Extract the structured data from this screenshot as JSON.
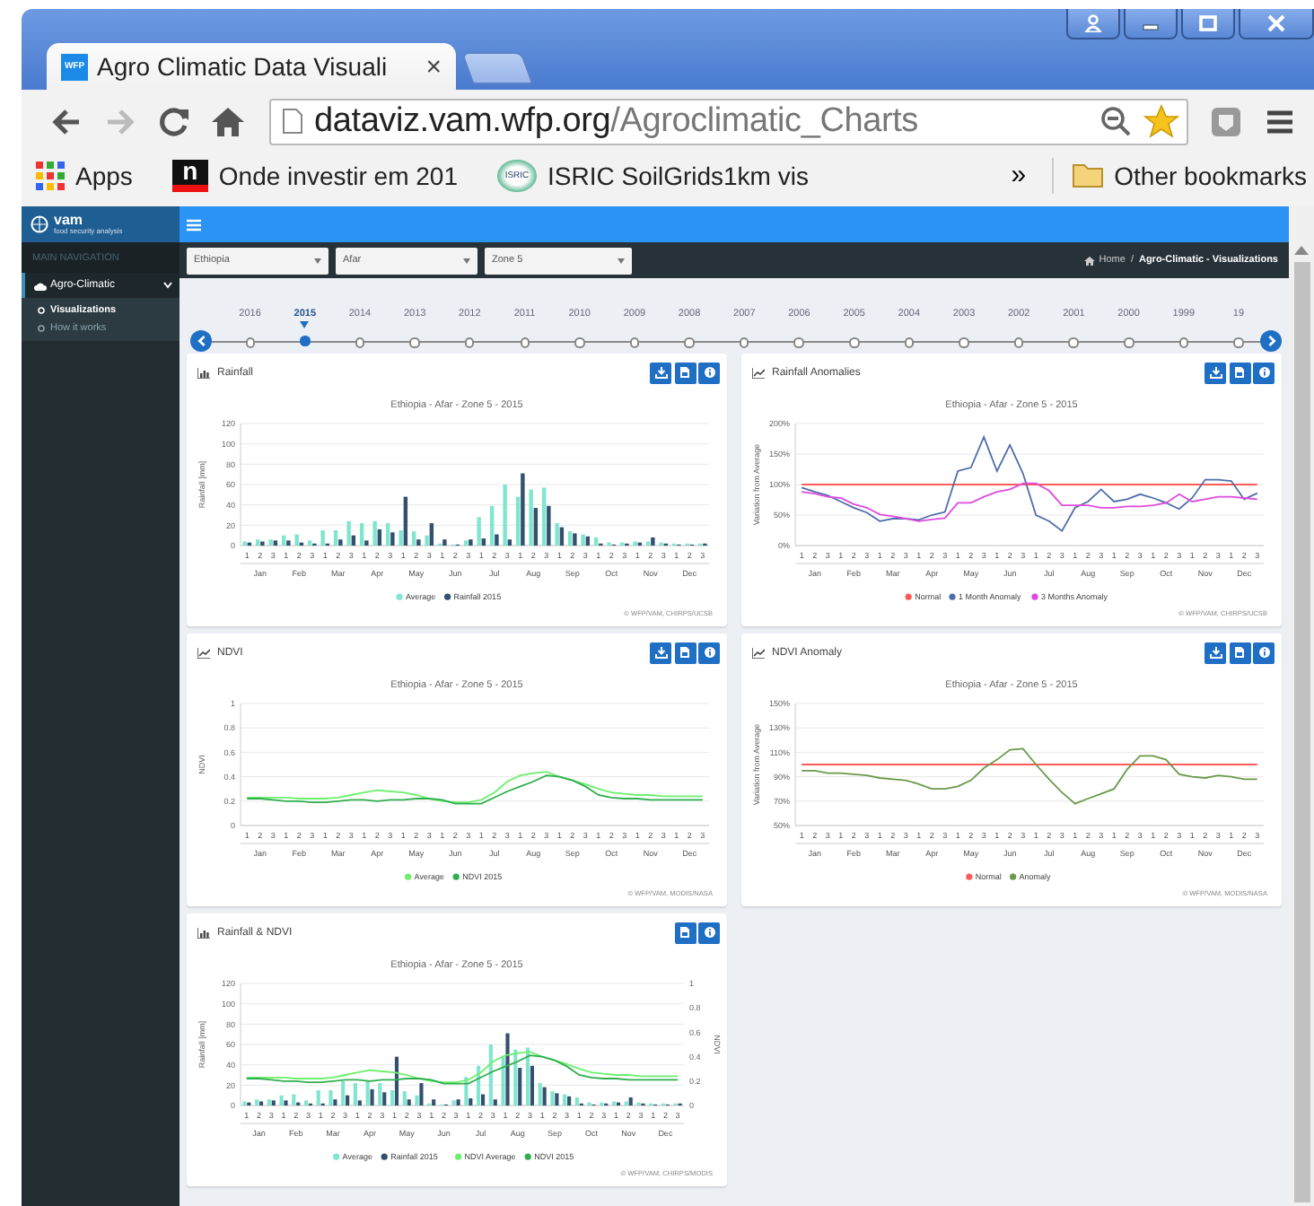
{
  "browser": {
    "tab": {
      "favicon": "WFP",
      "title": "Agro Climatic Data Visuali",
      "close": "×"
    },
    "url": {
      "host": "dataviz.vam.wfp.org",
      "path": "/Agroclimatic_Charts"
    },
    "bookmarks": [
      {
        "kind": "apps",
        "label": "Apps"
      },
      {
        "kind": "letter",
        "icon_text": "n",
        "label": "Onde investir em 201"
      },
      {
        "kind": "badge",
        "icon_text": "ISRIC",
        "label": "ISRIC SoilGrids1km vis"
      }
    ],
    "overflow": "»",
    "other_bookmarks": "Other bookmarks"
  },
  "sidebar": {
    "logo": {
      "name": "vam",
      "tagline": "food security analysis"
    },
    "header": "MAIN NAVIGATION",
    "menu": [
      {
        "label": "Agro-Climatic",
        "expanded": true,
        "children": [
          {
            "label": "Visualizations",
            "selected": true
          },
          {
            "label": "How it works",
            "selected": false
          }
        ]
      }
    ]
  },
  "filters": [
    {
      "value": "Ethiopia"
    },
    {
      "value": "Afar"
    },
    {
      "value": "Zone 5"
    }
  ],
  "breadcrumb": {
    "items": [
      {
        "label": "Home",
        "kind": "home"
      },
      {
        "label": "Agro-Climatic - Visualizations",
        "kind": "current"
      }
    ],
    "separator": "/"
  },
  "timeline": {
    "years": [
      {
        "label": "2016",
        "selected": false
      },
      {
        "label": "2015",
        "selected": true
      },
      {
        "label": "2014",
        "selected": false
      },
      {
        "label": "2013",
        "selected": false
      },
      {
        "label": "2012",
        "selected": false
      },
      {
        "label": "2011",
        "selected": false
      },
      {
        "label": "2010",
        "selected": false
      },
      {
        "label": "2009",
        "selected": false
      },
      {
        "label": "2008",
        "selected": false
      },
      {
        "label": "2007",
        "selected": false
      },
      {
        "label": "2006",
        "selected": false
      },
      {
        "label": "2005",
        "selected": false
      },
      {
        "label": "2004",
        "selected": false
      },
      {
        "label": "2003",
        "selected": false
      },
      {
        "label": "2002",
        "selected": false
      },
      {
        "label": "2001",
        "selected": false
      },
      {
        "label": "2000",
        "selected": false
      },
      {
        "label": "1999",
        "selected": false
      },
      {
        "label": "19",
        "selected": false
      }
    ]
  },
  "cards": [
    {
      "title": "Rainfall",
      "buttons": [
        {
          "kind": "download"
        },
        {
          "kind": "image"
        },
        {
          "kind": "info"
        }
      ],
      "credit": "© WFP/VAM, CHIRPS/UCSB",
      "months": [
        "Jan",
        "Feb",
        "Mar",
        "Apr",
        "May",
        "Jun",
        "Jul",
        "Aug",
        "Sep",
        "Oct",
        "Nov",
        "Dec"
      ],
      "chart_data": {
        "type": "bar",
        "title": "Ethiopia - Afar - Zone 5 - 2015",
        "ylabel": "Rainfall [mm]",
        "categories": [
          "1",
          "2",
          "3",
          "1",
          "2",
          "3",
          "1",
          "2",
          "3",
          "1",
          "2",
          "3",
          "1",
          "2",
          "3",
          "1",
          "2",
          "3",
          "1",
          "2",
          "3",
          "1",
          "2",
          "3",
          "1",
          "2",
          "3",
          "1",
          "2",
          "3",
          "1",
          "2",
          "3",
          "1",
          "2",
          "3"
        ],
        "ylim": [
          0,
          120
        ],
        "yticks": [
          0,
          20,
          40,
          60,
          80,
          100,
          120
        ],
        "grid": true,
        "legend": "bottom",
        "series": [
          {
            "name": "Average",
            "color": "#80e6cf",
            "values": [
              4,
              6,
              6,
              10,
              11,
              5,
              15,
              15,
              24,
              22,
              24,
              22,
              15,
              14,
              10,
              2,
              1,
              5,
              28,
              39,
              60,
              48,
              55,
              57,
              22,
              14,
              11,
              8,
              3,
              3,
              4,
              4,
              3,
              2,
              2,
              2
            ]
          },
          {
            "name": "Rainfall 2015",
            "color": "#34506f",
            "values": [
              3,
              4,
              5,
              5,
              3,
              2,
              2,
              6,
              10,
              5,
              16,
              13,
              48,
              6,
              22,
              6,
              1,
              6,
              7,
              11,
              6,
              71,
              37,
              39,
              18,
              12,
              9,
              2,
              1,
              2,
              3,
              8,
              2,
              1,
              1,
              2
            ]
          }
        ]
      }
    },
    {
      "title": "Rainfall Anomalies",
      "buttons": [
        {
          "kind": "download"
        },
        {
          "kind": "image"
        },
        {
          "kind": "info"
        }
      ],
      "credit": "© WFP/VAM, CHIRPS/UCSB",
      "months": [
        "Jan",
        "Feb",
        "Mar",
        "Apr",
        "May",
        "Jun",
        "Jul",
        "Aug",
        "Sep",
        "Oct",
        "Nov",
        "Dec"
      ],
      "chart_data": {
        "type": "line",
        "title": "Ethiopia - Afar - Zone 5 - 2015",
        "ylabel": "Variation from Average",
        "categories": [
          "1",
          "2",
          "3",
          "1",
          "2",
          "3",
          "1",
          "2",
          "3",
          "1",
          "2",
          "3",
          "1",
          "2",
          "3",
          "1",
          "2",
          "3",
          "1",
          "2",
          "3",
          "1",
          "2",
          "3",
          "1",
          "2",
          "3",
          "1",
          "2",
          "3",
          "1",
          "2",
          "3",
          "1",
          "2",
          "3"
        ],
        "grid": true,
        "legend": "bottom",
        "ylim": [
          0,
          200
        ],
        "yticks": [
          {
            "value": 0,
            "label": "0%"
          },
          {
            "value": 50,
            "label": "50%"
          },
          {
            "value": 100,
            "label": "100%"
          },
          {
            "value": 150,
            "label": "150%"
          },
          {
            "value": 200,
            "label": "200%"
          }
        ],
        "series": [
          {
            "name": "Normal",
            "color": "#ff5a5a",
            "values": [
              100,
              100,
              100,
              100,
              100,
              100,
              100,
              100,
              100,
              100,
              100,
              100,
              100,
              100,
              100,
              100,
              100,
              100,
              100,
              100,
              100,
              100,
              100,
              100,
              100,
              100,
              100,
              100,
              100,
              100,
              100,
              100,
              100,
              100,
              100,
              100
            ]
          },
          {
            "name": "1 Month Anomaly",
            "color": "#4e6ea8",
            "values": [
              95,
              88,
              82,
              72,
              62,
              54,
              40,
              44,
              44,
              42,
              50,
              55,
              122,
              128,
              178,
              122,
              165,
              118,
              50,
              40,
              24,
              62,
              72,
              92,
              72,
              76,
              84,
              78,
              70,
              60,
              78,
              108,
              108,
              106,
              76,
              86
            ]
          },
          {
            "name": "3 Months Anomaly",
            "color": "#e04ae0",
            "values": [
              88,
              85,
              80,
              78,
              68,
              62,
              51,
              48,
              44,
              40,
              43,
              45,
              70,
              70,
              80,
              88,
              92,
              102,
              102,
              90,
              66,
              66,
              66,
              62,
              62,
              64,
              64,
              66,
              70,
              84,
              72,
              76,
              80,
              80,
              78,
              76
            ]
          }
        ]
      }
    },
    {
      "title": "NDVI",
      "buttons": [
        {
          "kind": "download"
        },
        {
          "kind": "image"
        },
        {
          "kind": "info"
        }
      ],
      "credit": "© WFP/VAM, MODIS/NASA",
      "months": [
        "Jan",
        "Feb",
        "Mar",
        "Apr",
        "May",
        "Jun",
        "Jul",
        "Aug",
        "Sep",
        "Oct",
        "Nov",
        "Dec"
      ],
      "chart_data": {
        "type": "line",
        "title": "Ethiopia - Afar - Zone 5 - 2015",
        "ylabel": "NDVI",
        "categories": [
          "1",
          "2",
          "3",
          "1",
          "2",
          "3",
          "1",
          "2",
          "3",
          "1",
          "2",
          "3",
          "1",
          "2",
          "3",
          "1",
          "2",
          "3",
          "1",
          "2",
          "3",
          "1",
          "2",
          "3",
          "1",
          "2",
          "3",
          "1",
          "2",
          "3",
          "1",
          "2",
          "3",
          "1",
          "2",
          "3"
        ],
        "ylim": [
          0,
          1
        ],
        "yticks": [
          0,
          0.2,
          0.4,
          0.6,
          0.8,
          1
        ],
        "grid": true,
        "legend": "bottom",
        "series": [
          {
            "name": "Average",
            "color": "#6cf06c",
            "values": [
              0.23,
              0.23,
              0.23,
              0.23,
              0.22,
              0.22,
              0.22,
              0.23,
              0.25,
              0.27,
              0.29,
              0.28,
              0.27,
              0.25,
              0.22,
              0.2,
              0.19,
              0.19,
              0.21,
              0.27,
              0.36,
              0.41,
              0.43,
              0.44,
              0.4,
              0.37,
              0.34,
              0.3,
              0.27,
              0.26,
              0.25,
              0.25,
              0.24,
              0.24,
              0.24,
              0.24
            ]
          },
          {
            "name": "NDVI 2015",
            "color": "#2fae4e",
            "values": [
              0.22,
              0.22,
              0.21,
              0.2,
              0.2,
              0.19,
              0.19,
              0.2,
              0.21,
              0.21,
              0.2,
              0.21,
              0.21,
              0.22,
              0.22,
              0.21,
              0.18,
              0.18,
              0.18,
              0.23,
              0.28,
              0.32,
              0.36,
              0.41,
              0.4,
              0.37,
              0.32,
              0.25,
              0.23,
              0.22,
              0.22,
              0.21,
              0.21,
              0.21,
              0.21,
              0.21
            ]
          }
        ]
      }
    },
    {
      "title": "NDVI Anomaly",
      "buttons": [
        {
          "kind": "download"
        },
        {
          "kind": "image"
        },
        {
          "kind": "info"
        }
      ],
      "credit": "© WFP/VAM, MODIS/NASA",
      "months": [
        "Jan",
        "Feb",
        "Mar",
        "Apr",
        "May",
        "Jun",
        "Jul",
        "Aug",
        "Sep",
        "Oct",
        "Nov",
        "Dec"
      ],
      "chart_data": {
        "type": "line",
        "title": "Ethiopia - Afar - Zone 5 - 2015",
        "ylabel": "Variation from Average",
        "categories": [
          "1",
          "2",
          "3",
          "1",
          "2",
          "3",
          "1",
          "2",
          "3",
          "1",
          "2",
          "3",
          "1",
          "2",
          "3",
          "1",
          "2",
          "3",
          "1",
          "2",
          "3",
          "1",
          "2",
          "3",
          "1",
          "2",
          "3",
          "1",
          "2",
          "3",
          "1",
          "2",
          "3",
          "1",
          "2",
          "3"
        ],
        "grid": true,
        "legend": "bottom",
        "ylim": [
          50,
          150
        ],
        "yticks": [
          {
            "value": 50,
            "label": "50%"
          },
          {
            "value": 70,
            "label": "70%"
          },
          {
            "value": 90,
            "label": "90%"
          },
          {
            "value": 110,
            "label": "110%"
          },
          {
            "value": 130,
            "label": "130%"
          },
          {
            "value": 150,
            "label": "150%"
          }
        ],
        "series": [
          {
            "name": "Normal",
            "color": "#ff5a5a",
            "values": [
              100,
              100,
              100,
              100,
              100,
              100,
              100,
              100,
              100,
              100,
              100,
              100,
              100,
              100,
              100,
              100,
              100,
              100,
              100,
              100,
              100,
              100,
              100,
              100,
              100,
              100,
              100,
              100,
              100,
              100,
              100,
              100,
              100,
              100,
              100,
              100
            ]
          },
          {
            "name": "Anomaly",
            "color": "#6a9a4a",
            "values": [
              95,
              95,
              93,
              93,
              92,
              91,
              89,
              88,
              87,
              84,
              80,
              80,
              82,
              87,
              97,
              104,
              112,
              113,
              100,
              88,
              77,
              68,
              72,
              76,
              80,
              96,
              107,
              107,
              104,
              92,
              90,
              89,
              91,
              90,
              88,
              88
            ]
          }
        ]
      }
    },
    {
      "title": "Rainfall & NDVI",
      "buttons": [
        {
          "kind": "image"
        },
        {
          "kind": "info"
        }
      ],
      "credit": "© WFP/VAM, CHIRPS/MODIS",
      "months": [
        "Jan",
        "Feb",
        "Mar",
        "Apr",
        "May",
        "Jun",
        "Jul",
        "Aug",
        "Sep",
        "Oct",
        "Nov",
        "Dec"
      ],
      "chart_data": {
        "type": "bar",
        "title": "Ethiopia - Afar - Zone 5 - 2015",
        "ylabel": "Rainfall [mm]",
        "y2label": "NDVI",
        "categories": [
          "1",
          "2",
          "3",
          "1",
          "2",
          "3",
          "1",
          "2",
          "3",
          "1",
          "2",
          "3",
          "1",
          "2",
          "3",
          "1",
          "2",
          "3",
          "1",
          "2",
          "3",
          "1",
          "2",
          "3",
          "1",
          "2",
          "3",
          "1",
          "2",
          "3",
          "1",
          "2",
          "3",
          "1",
          "2",
          "3"
        ],
        "ylim": [
          0,
          120
        ],
        "yticks": [
          0,
          20,
          40,
          60,
          80,
          100,
          120
        ],
        "y2lim": [
          0,
          1
        ],
        "y2ticks": [
          0,
          0.2,
          0.4,
          0.6,
          0.8,
          1
        ],
        "grid": true,
        "legend": "bottom",
        "series": [
          {
            "name": "Average",
            "color": "#80e6cf",
            "values": [
              4,
              6,
              6,
              10,
              11,
              5,
              15,
              15,
              24,
              22,
              24,
              22,
              15,
              14,
              10,
              2,
              1,
              5,
              28,
              39,
              60,
              48,
              55,
              57,
              22,
              14,
              11,
              8,
              3,
              3,
              4,
              4,
              3,
              2,
              2,
              2
            ]
          },
          {
            "name": "Rainfall 2015",
            "color": "#34506f",
            "values": [
              3,
              4,
              5,
              5,
              3,
              2,
              2,
              6,
              10,
              5,
              16,
              13,
              48,
              6,
              22,
              6,
              1,
              6,
              7,
              11,
              6,
              71,
              37,
              39,
              18,
              12,
              9,
              2,
              1,
              2,
              3,
              8,
              2,
              1,
              1,
              2
            ]
          },
          {
            "name": "NDVI Average",
            "type": "line",
            "axis": "y2",
            "color": "#6cf06c",
            "values": [
              0.23,
              0.23,
              0.23,
              0.23,
              0.22,
              0.22,
              0.22,
              0.23,
              0.25,
              0.27,
              0.29,
              0.28,
              0.27,
              0.25,
              0.22,
              0.2,
              0.19,
              0.19,
              0.21,
              0.27,
              0.36,
              0.41,
              0.43,
              0.44,
              0.4,
              0.37,
              0.34,
              0.3,
              0.27,
              0.26,
              0.25,
              0.25,
              0.24,
              0.24,
              0.24,
              0.24
            ]
          },
          {
            "name": "NDVI 2015",
            "type": "line",
            "axis": "y2",
            "color": "#2fae4e",
            "values": [
              0.22,
              0.22,
              0.21,
              0.2,
              0.2,
              0.19,
              0.19,
              0.2,
              0.21,
              0.21,
              0.2,
              0.21,
              0.21,
              0.22,
              0.22,
              0.21,
              0.18,
              0.18,
              0.18,
              0.23,
              0.28,
              0.32,
              0.36,
              0.41,
              0.4,
              0.37,
              0.32,
              0.25,
              0.23,
              0.22,
              0.22,
              0.21,
              0.21,
              0.21,
              0.21,
              0.21
            ]
          }
        ]
      }
    }
  ]
}
